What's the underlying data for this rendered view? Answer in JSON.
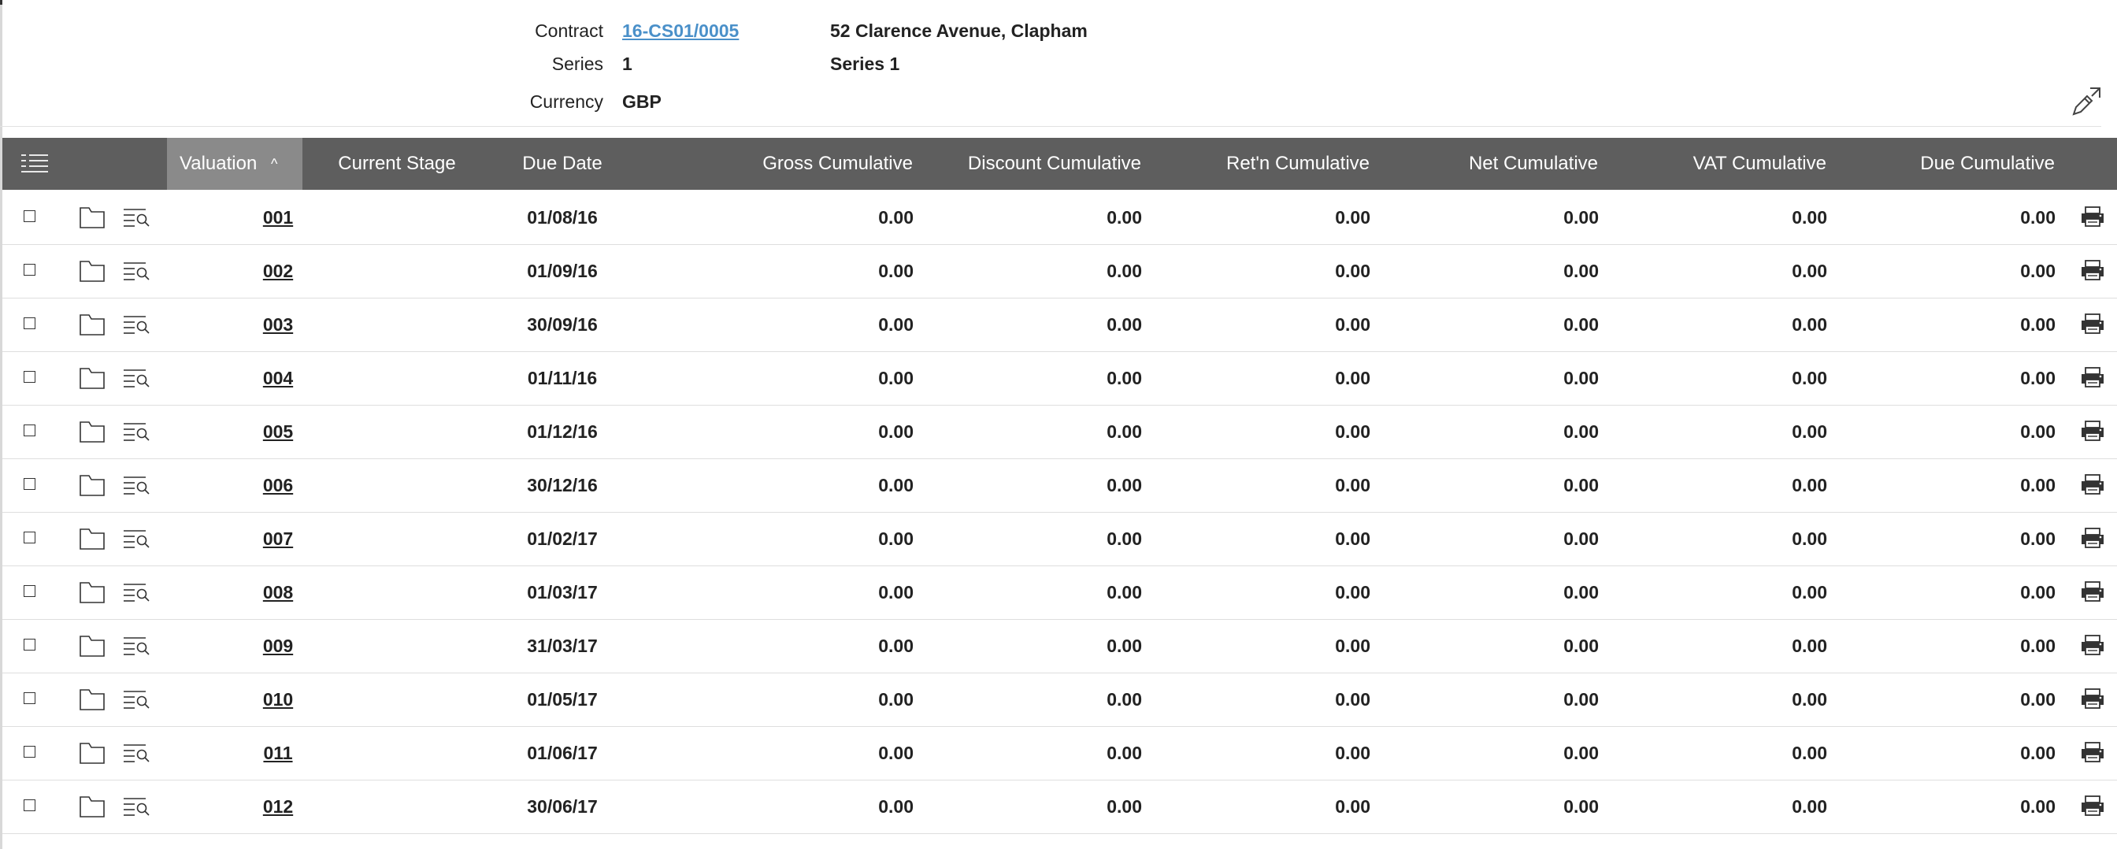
{
  "header": {
    "contract_label": "Contract",
    "contract_value": "16-CS01/0005",
    "contract_name": "52 Clarence Avenue, Clapham",
    "series_label": "Series",
    "series_value": "1",
    "series_name": "Series 1",
    "currency_label": "Currency",
    "currency_value": "GBP",
    "edit_icon": "pencil-expand-icon"
  },
  "table": {
    "menu_icon": "list-menu-icon",
    "columns": {
      "valuation": "Valuation",
      "valuation_sort": "^",
      "current_stage": "Current Stage",
      "due_date": "Due Date",
      "gross": "Gross Cumulative",
      "discount": "Discount Cumulative",
      "retn": "Ret'n Cumulative",
      "net": "Net Cumulative",
      "vat": "VAT Cumulative",
      "due": "Due Cumulative"
    },
    "row_icons": [
      "checkbox",
      "folder-icon",
      "search-list-icon",
      "printer-icon"
    ],
    "rows": [
      {
        "valuation": "001",
        "stage": "",
        "due_date": "01/08/16",
        "gross": "0.00",
        "discount": "0.00",
        "retn": "0.00",
        "net": "0.00",
        "vat": "0.00",
        "due": "0.00"
      },
      {
        "valuation": "002",
        "stage": "",
        "due_date": "01/09/16",
        "gross": "0.00",
        "discount": "0.00",
        "retn": "0.00",
        "net": "0.00",
        "vat": "0.00",
        "due": "0.00"
      },
      {
        "valuation": "003",
        "stage": "",
        "due_date": "30/09/16",
        "gross": "0.00",
        "discount": "0.00",
        "retn": "0.00",
        "net": "0.00",
        "vat": "0.00",
        "due": "0.00"
      },
      {
        "valuation": "004",
        "stage": "",
        "due_date": "01/11/16",
        "gross": "0.00",
        "discount": "0.00",
        "retn": "0.00",
        "net": "0.00",
        "vat": "0.00",
        "due": "0.00"
      },
      {
        "valuation": "005",
        "stage": "",
        "due_date": "01/12/16",
        "gross": "0.00",
        "discount": "0.00",
        "retn": "0.00",
        "net": "0.00",
        "vat": "0.00",
        "due": "0.00"
      },
      {
        "valuation": "006",
        "stage": "",
        "due_date": "30/12/16",
        "gross": "0.00",
        "discount": "0.00",
        "retn": "0.00",
        "net": "0.00",
        "vat": "0.00",
        "due": "0.00"
      },
      {
        "valuation": "007",
        "stage": "",
        "due_date": "01/02/17",
        "gross": "0.00",
        "discount": "0.00",
        "retn": "0.00",
        "net": "0.00",
        "vat": "0.00",
        "due": "0.00"
      },
      {
        "valuation": "008",
        "stage": "",
        "due_date": "01/03/17",
        "gross": "0.00",
        "discount": "0.00",
        "retn": "0.00",
        "net": "0.00",
        "vat": "0.00",
        "due": "0.00"
      },
      {
        "valuation": "009",
        "stage": "",
        "due_date": "31/03/17",
        "gross": "0.00",
        "discount": "0.00",
        "retn": "0.00",
        "net": "0.00",
        "vat": "0.00",
        "due": "0.00"
      },
      {
        "valuation": "010",
        "stage": "",
        "due_date": "01/05/17",
        "gross": "0.00",
        "discount": "0.00",
        "retn": "0.00",
        "net": "0.00",
        "vat": "0.00",
        "due": "0.00"
      },
      {
        "valuation": "011",
        "stage": "",
        "due_date": "01/06/17",
        "gross": "0.00",
        "discount": "0.00",
        "retn": "0.00",
        "net": "0.00",
        "vat": "0.00",
        "due": "0.00"
      },
      {
        "valuation": "012",
        "stage": "",
        "due_date": "30/06/17",
        "gross": "0.00",
        "discount": "0.00",
        "retn": "0.00",
        "net": "0.00",
        "vat": "0.00",
        "due": "0.00"
      }
    ]
  },
  "colors": {
    "header_bg": "#5e5e5e",
    "active_header_bg": "#8a8a8a",
    "link": "#4a90c9",
    "row_border": "#dedede"
  }
}
